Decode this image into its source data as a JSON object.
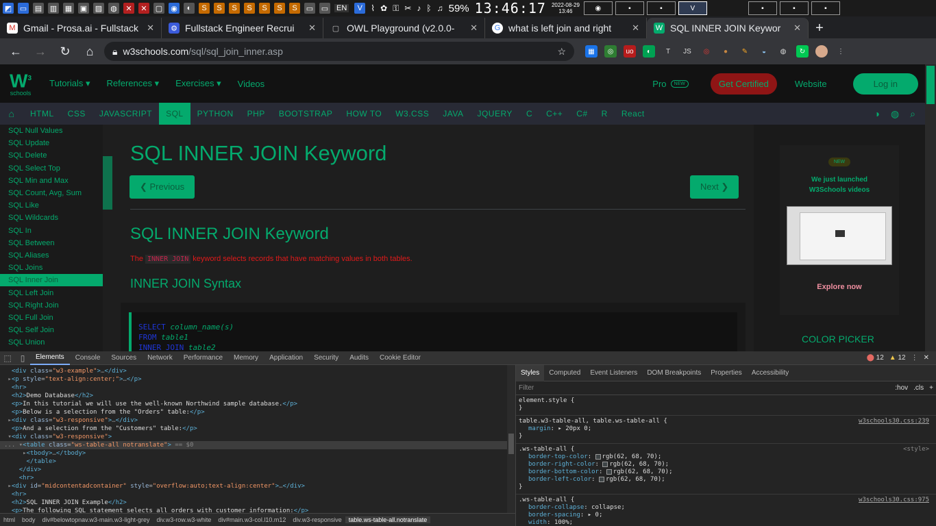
{
  "taskbar": {
    "lang": "EN",
    "battery": "59%",
    "clock": "13:46:17",
    "date": "2022-08-29",
    "time": "13:46"
  },
  "tabs": [
    {
      "title": "Gmail - Prosa.ai - Fullstack",
      "favicon": "M",
      "color": "#d93025"
    },
    {
      "title": "Fullstack Engineer Recrui",
      "favicon": "⚙",
      "color": "#3b5bdb"
    },
    {
      "title": "OWL Playground (v2.0.0-",
      "favicon": "▢",
      "color": "#666666"
    },
    {
      "title": "what is left join and right",
      "favicon": "G",
      "color": "#4285f4"
    },
    {
      "title": "SQL INNER JOIN Keywor",
      "favicon": "W",
      "color": "#04aa6d"
    }
  ],
  "address": {
    "host": "w3schools.com",
    "path": "/sql/sql_join_inner.asp"
  },
  "topnav": {
    "logo": "W",
    "logo_sup": "3",
    "logo_sub": "schools",
    "menu": [
      "Tutorials ▾",
      "References ▾",
      "Exercises ▾",
      "Videos"
    ],
    "pro": "Pro",
    "pro_badge": "NEW",
    "get_certified": "Get Certified",
    "website": "Website",
    "login": "Log in"
  },
  "subnav": [
    "HTML",
    "CSS",
    "JAVASCRIPT",
    "SQL",
    "PYTHON",
    "PHP",
    "BOOTSTRAP",
    "HOW TO",
    "W3.CSS",
    "JAVA",
    "JQUERY",
    "C",
    "C++",
    "C#",
    "R",
    "React"
  ],
  "subnav_active": "SQL",
  "sidebar": [
    "SQL Null Values",
    "SQL Update",
    "SQL Delete",
    "SQL Select Top",
    "SQL Min and Max",
    "SQL Count, Avg, Sum",
    "SQL Like",
    "SQL Wildcards",
    "SQL In",
    "SQL Between",
    "SQL Aliases",
    "SQL Joins",
    "SQL Inner Join",
    "SQL Left Join",
    "SQL Right Join",
    "SQL Full Join",
    "SQL Self Join",
    "SQL Union"
  ],
  "sidebar_active": "SQL Inner Join",
  "main": {
    "h1": "SQL INNER JOIN Keyword",
    "prev": "❮ Previous",
    "next": "Next ❯",
    "h2": "SQL INNER JOIN Keyword",
    "intro_pre": "The ",
    "intro_code": "INNER JOIN",
    "intro_post": " keyword selects records that have matching values in both tables.",
    "h3": "INNER JOIN Syntax",
    "code": [
      {
        "kw": "SELECT",
        "id": "column_name(s)"
      },
      {
        "kw": "FROM",
        "id": "table1"
      },
      {
        "kw": "INNER JOIN",
        "id": "table2"
      }
    ]
  },
  "right": {
    "new": "NEW",
    "line1": "We just launched",
    "line2": "W3Schools videos",
    "explore": "Explore now",
    "color_picker": "COLOR PICKER"
  },
  "devtools": {
    "tabs": [
      "Elements",
      "Console",
      "Sources",
      "Network",
      "Performance",
      "Memory",
      "Application",
      "Security",
      "Audits",
      "Cookie Editor"
    ],
    "errors": "12",
    "warnings": "12",
    "breadcrumbs": [
      "html",
      "body",
      "div#belowtopnav.w3-main.w3-light-grey",
      "div.w3-row.w3-white",
      "div#main.w3-col.l10.m12",
      "div.w3-responsive",
      "table.ws-table-all.notranslate"
    ],
    "style_tabs": [
      "Styles",
      "Computed",
      "Event Listeners",
      "DOM Breakpoints",
      "Properties",
      "Accessibility"
    ],
    "filter_placeholder": "Filter",
    "hov": ":hov",
    "cls": ".cls",
    "plus": "+"
  }
}
